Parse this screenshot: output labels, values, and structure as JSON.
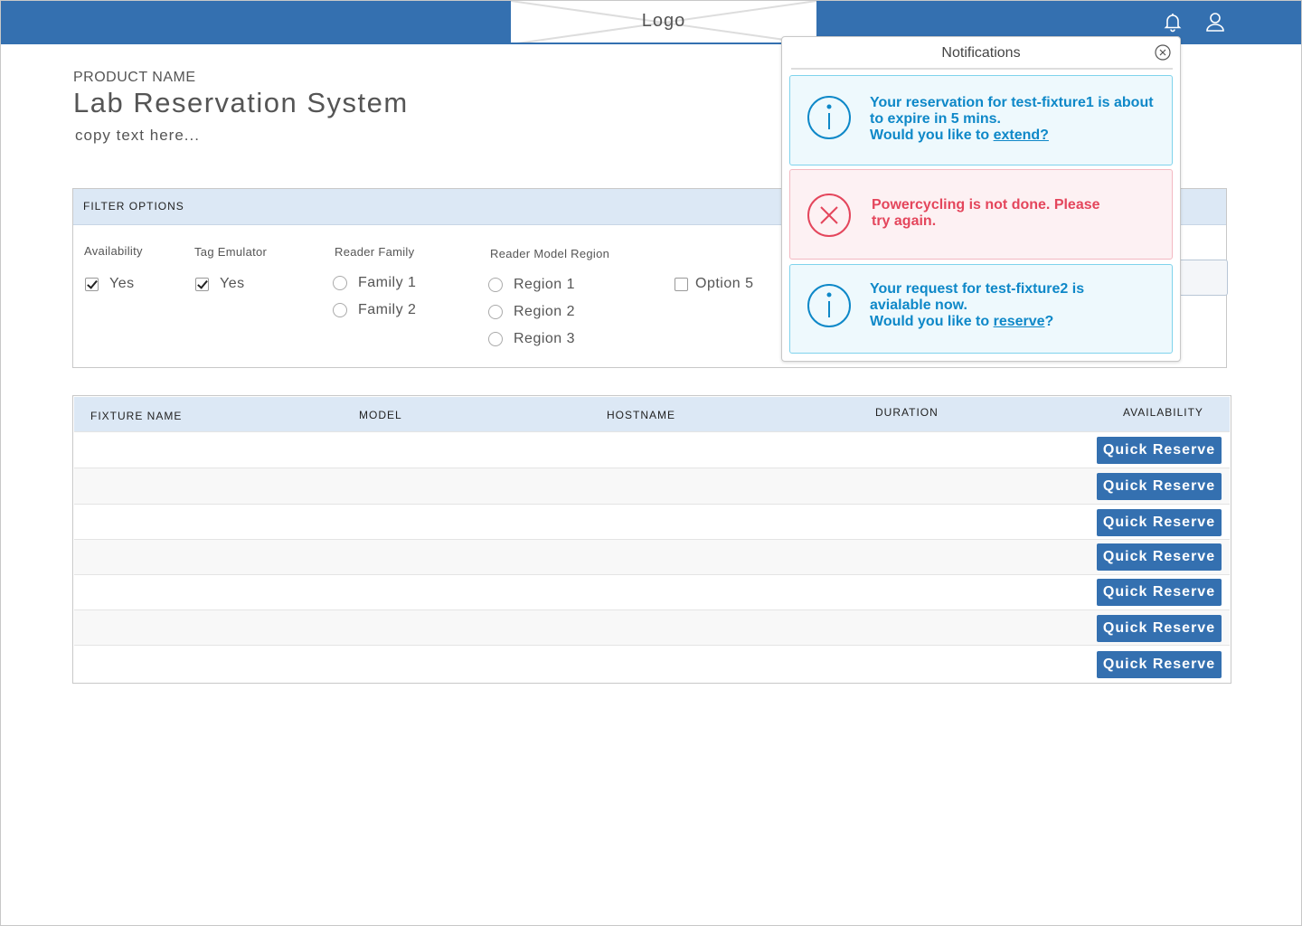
{
  "header": {
    "logo": "Logo",
    "bell_icon": "bell-icon",
    "user_icon": "user-icon"
  },
  "product": {
    "name": "PRODUCT NAME",
    "title": "Lab Reservation System",
    "copy": "copy text here..."
  },
  "filters": {
    "title": "FILTER OPTIONS",
    "availability": {
      "label": "Availability",
      "option": "Yes",
      "checked": true
    },
    "tag_emulator": {
      "label": "Tag Emulator",
      "option": "Yes",
      "checked": true
    },
    "reader_family": {
      "label": "Reader Family",
      "options": [
        "Family 1",
        "Family 2"
      ]
    },
    "reader_model_region": {
      "label": "Reader Model Region",
      "options": [
        "Region 1",
        "Region 2",
        "Region 3"
      ]
    },
    "option5": {
      "label": "Option 5",
      "checked": false
    }
  },
  "table": {
    "columns": [
      "FIXTURE NAME",
      "MODEL",
      "HOSTNAME",
      "DURATION",
      "AVAILABILITY"
    ],
    "row_count": 7,
    "action_label": "Quick Reserve"
  },
  "notifications": {
    "title": "Notifications",
    "items": [
      {
        "type": "info",
        "line1": "Your reservation for test-fixture1 is about",
        "line2": "to expire in 5 mins.",
        "line3_prefix": "Would you like to ",
        "link": "extend?",
        "line3_suffix": ""
      },
      {
        "type": "error",
        "line1": "Powercycling is not done. Please",
        "line2": "try again."
      },
      {
        "type": "info",
        "line1": "Your request for test-fixture2 is",
        "line2": "avialable now.",
        "line3_prefix": "Would you like to ",
        "link": "reserve",
        "line3_suffix": "?"
      }
    ]
  },
  "colors": {
    "brand": "#3470b0",
    "header_bg": "#dce8f5",
    "info": "#0e88c8",
    "error": "#e4465c"
  }
}
